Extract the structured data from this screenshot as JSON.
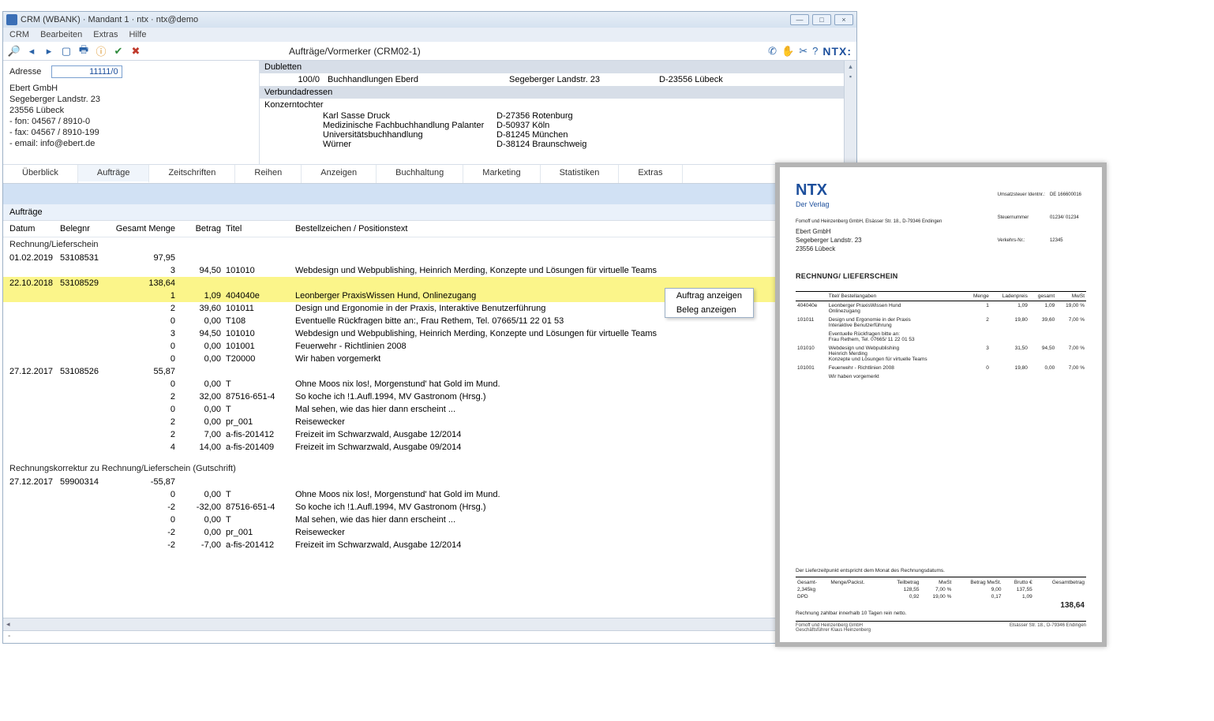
{
  "window": {
    "title": "CRM (WBANK) · Mandant 1 · ntx · ntx@demo",
    "min": "—",
    "max": "□",
    "close": "×"
  },
  "menu": {
    "items": [
      "CRM",
      "Bearbeiten",
      "Extras",
      "Hilfe"
    ]
  },
  "toolbar": {
    "title": "Aufträge/Vormerker (CRM02-1)",
    "brand": "NTX:"
  },
  "address": {
    "label": "Adresse",
    "value": "11111/0",
    "block": [
      "Ebert GmbH",
      "Segeberger Landstr. 23",
      "23556 Lübeck",
      "- fon:  04567 / 8910-0",
      "- fax:  04567 / 8910-199",
      "- email: info@ebert.de"
    ]
  },
  "dub": {
    "h1": "Dubletten",
    "row": {
      "id": "100/0",
      "name": "Buchhandlungen Eberd",
      "street": "Segeberger Landstr. 23",
      "city": "D-23556 Lübeck"
    },
    "h2": "Verbundadressen",
    "h3": "Konzerntochter",
    "subs": [
      {
        "name": "Karl Sasse Druck",
        "city": "D-27356 Rotenburg"
      },
      {
        "name": "Medizinische Fachbuchhandlung Palanter",
        "city": "D-50937 Köln"
      },
      {
        "name": "Universitätsbuchhandlung",
        "city": "D-81245 München"
      },
      {
        "name": "Würner",
        "city": "D-38124 Braunschweig"
      }
    ]
  },
  "tabs": [
    "Überblick",
    "Aufträge",
    "Zeitschriften",
    "Reihen",
    "Anzeigen",
    "Buchhaltung",
    "Marketing",
    "Statistiken",
    "Extras"
  ],
  "activeTab": "Aufträge",
  "orders": {
    "heading": "Aufträge",
    "cols": {
      "d": "Datum",
      "b": "Belegnr",
      "g": "Gesamt Menge",
      "bt": "Betrag",
      "t": "Titel",
      "x": "Bestellzeichen / Positionstext"
    },
    "group1": "Rechnung/Lieferschein",
    "items": [
      {
        "d": "01.02.2019",
        "b": "53108531",
        "g": "97,95",
        "lines": [
          {
            "m": "3",
            "bt": "94,50",
            "t": "101010",
            "x": "Webdesign und Webpublishing, Heinrich Merding, Konzepte und Lösungen für virtuelle Teams"
          }
        ]
      },
      {
        "d": "22.10.2018",
        "b": "53108529",
        "g": "138,64",
        "hl": true,
        "lines": [
          {
            "m": "1",
            "bt": "1,09",
            "t": "404040e",
            "x": "Leonberger PraxisWissen Hund, Onlinezugang",
            "hl": true
          },
          {
            "m": "2",
            "bt": "39,60",
            "t": "101011",
            "x": "Design und Ergonomie in der Praxis, Interaktive Benutzerführung"
          },
          {
            "m": "0",
            "bt": "0,00",
            "t": "T108",
            "x": "Eventuelle Rückfragen bitte an:, Frau Rethem, Tel. 07665/11 22 01 53"
          },
          {
            "m": "3",
            "bt": "94,50",
            "t": "101010",
            "x": "Webdesign und Webpublishing, Heinrich Merding, Konzepte und Lösungen für virtuelle Teams"
          },
          {
            "m": "0",
            "bt": "0,00",
            "t": "101001",
            "x": "Feuerwehr - Richtlinien 2008"
          },
          {
            "m": "0",
            "bt": "0,00",
            "t": "T20000",
            "x": "Wir haben vorgemerkt"
          }
        ]
      },
      {
        "d": "27.12.2017",
        "b": "53108526",
        "g": "55,87",
        "lines": [
          {
            "m": "0",
            "bt": "0,00",
            "t": "T",
            "x": "Ohne Moos nix los!, Morgenstund' hat Gold im Mund."
          },
          {
            "m": "2",
            "bt": "32,00",
            "t": "87516-651-4",
            "x": "So koche ich !1.Aufl.1994, MV Gastronom (Hrsg.)"
          },
          {
            "m": "0",
            "bt": "0,00",
            "t": "T",
            "x": "Mal sehen, wie das hier dann erscheint ..."
          },
          {
            "m": "2",
            "bt": "0,00",
            "t": "pr_001",
            "x": "Reisewecker"
          },
          {
            "m": "2",
            "bt": "7,00",
            "t": "a-fis-201412",
            "x": "Freizeit im Schwarzwald, Ausgabe 12/2014"
          },
          {
            "m": "4",
            "bt": "14,00",
            "t": "a-fis-201409",
            "x": "Freizeit im Schwarzwald, Ausgabe 09/2014"
          }
        ]
      }
    ],
    "group2": "Rechnungskorrektur zu Rechnung/Lieferschein (Gutschrift)",
    "items2": [
      {
        "d": "27.12.2017",
        "b": "59900314",
        "g": "-55,87",
        "lines": [
          {
            "m": "0",
            "bt": "0,00",
            "t": "T",
            "x": "Ohne Moos nix los!, Morgenstund' hat Gold im Mund."
          },
          {
            "m": "-2",
            "bt": "-32,00",
            "t": "87516-651-4",
            "x": "So koche ich !1.Aufl.1994, MV Gastronom (Hrsg.)"
          },
          {
            "m": "0",
            "bt": "0,00",
            "t": "T",
            "x": "Mal sehen, wie das hier dann erscheint ..."
          },
          {
            "m": "-2",
            "bt": "0,00",
            "t": "pr_001",
            "x": "Reisewecker"
          },
          {
            "m": "-2",
            "bt": "-7,00",
            "t": "a-fis-201412",
            "x": "Freizeit im Schwarzwald, Ausgabe 12/2014"
          }
        ]
      }
    ]
  },
  "context": {
    "a": "Auftrag anzeigen",
    "b": "Beleg anzeigen"
  },
  "status": "-",
  "invoice": {
    "brand": "NTX",
    "brandSub": "Der Verlag",
    "meta": [
      [
        "Umsatzsteuer Identnr.:",
        "DE 166600016"
      ],
      [
        "Steuernummer",
        "01234/ 01234"
      ],
      [
        "Verkehrs-Nr.:",
        "12345"
      ]
    ],
    "sender": "Fomoff und Heinzenberg GmbH, Elsässer Str. 18., D-79346 Endingen",
    "addr": [
      "Ebert GmbH",
      "Segeberger Landstr. 23",
      "23556 Lübeck"
    ],
    "title": "RECHNUNG/ LIEFERSCHEIN",
    "cols": [
      "",
      "Titel/ Bestellangaben",
      "Menge",
      "Ladenpreis",
      "gesamt",
      "MwSt"
    ],
    "rows": [
      [
        "404040e",
        "Leonberger PraxisWissen Hund\nOnlinezugang",
        "1",
        "1,09",
        "1,09",
        "19,00 %"
      ],
      [
        "101011",
        "Design und Ergonomie in der Praxis\nInteraktive Benutzerführung",
        "2",
        "19,80",
        "39,60",
        "7,00 %"
      ],
      [
        "",
        "Eventuelle Rückfragen bitte an:\nFrau Rethem, Tel. 07665/ 11 22 01 53",
        "",
        "",
        "",
        ""
      ],
      [
        "101010",
        "Webdesign und Webpublishing\nHeinrich Merding\nKonzepte und Lösungen für virtuelle Teams",
        "3",
        "31,50",
        "94,50",
        "7,00 %"
      ],
      [
        "101001",
        "Feuerwehr - Richtlinien 2008",
        "0",
        "19,80",
        "0,00",
        "7,00 %"
      ],
      [
        "",
        "Wir haben vorgemerkt",
        "",
        "",
        "",
        ""
      ]
    ],
    "footNote": "Der Lieferzeitpunkt entspricht dem Monat des Rechnungsdatums.",
    "footCols": [
      "Gesamt-",
      "Menge/Packst.",
      "Teilbetrag",
      "MwSt",
      "Betrag MwSt.",
      "Brutto €",
      "Gesamtbetrag"
    ],
    "footRows": [
      [
        "2,345kg",
        "",
        "128,55",
        "7,00 %",
        "9,00",
        "137,55",
        ""
      ],
      [
        "DPD",
        "",
        "0,92",
        "19,00 %",
        "0,17",
        "1,09",
        ""
      ]
    ],
    "total": "138,64",
    "payNote": "Rechnung zahlbar innerhalb 10 Tagen rein netto.",
    "bottomL": "Fomoff und Heinzenberg GmbH\nGeschäftsführer Klaus Heinzenberg",
    "bottomR": "Elsässer Str. 18., D-79346 Endingen"
  }
}
